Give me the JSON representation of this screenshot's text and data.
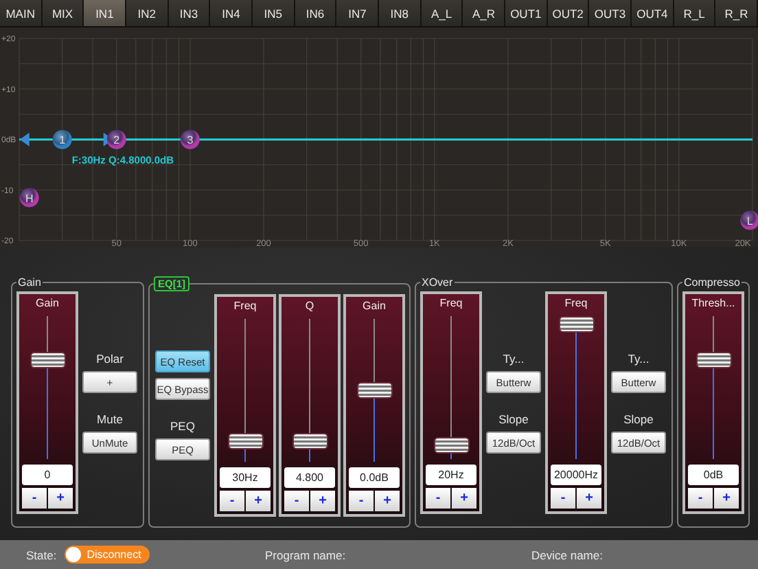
{
  "tabs": [
    {
      "label": "MAIN",
      "selected": false
    },
    {
      "label": "MIX",
      "selected": false
    },
    {
      "label": "IN1",
      "selected": true
    },
    {
      "label": "IN2",
      "selected": false
    },
    {
      "label": "IN3",
      "selected": false
    },
    {
      "label": "IN4",
      "selected": false
    },
    {
      "label": "IN5",
      "selected": false
    },
    {
      "label": "IN6",
      "selected": false
    },
    {
      "label": "IN7",
      "selected": false
    },
    {
      "label": "IN8",
      "selected": false
    },
    {
      "label": "A_L",
      "selected": false
    },
    {
      "label": "A_R",
      "selected": false
    },
    {
      "label": "OUT1",
      "selected": false
    },
    {
      "label": "OUT2",
      "selected": false
    },
    {
      "label": "OUT3",
      "selected": false
    },
    {
      "label": "OUT4",
      "selected": false
    },
    {
      "label": "R_L",
      "selected": false
    },
    {
      "label": "R_R",
      "selected": false
    }
  ],
  "graph": {
    "y_labels": [
      "+20",
      "+10",
      "0dB",
      "-10",
      "-20"
    ],
    "x_labels": [
      "50",
      "100",
      "200",
      "500",
      "1K",
      "2K",
      "5K",
      "10K",
      "20K"
    ],
    "nodes": [
      {
        "label": "1",
        "selected": true
      },
      {
        "label": "2",
        "selected": false
      },
      {
        "label": "3",
        "selected": false
      },
      {
        "label": "H",
        "selected": false
      },
      {
        "label": "L",
        "selected": false
      }
    ],
    "readout": "F:30Hz Q:4.8000.0dB"
  },
  "groups": [
    {
      "legend": "Gain",
      "kind": "plain",
      "items": [
        {
          "kind": "strip",
          "title": "Gain",
          "level": 0.72,
          "value": "0",
          "minus": "-",
          "plus": "+"
        },
        {
          "kind": "controls",
          "entries": [
            {
              "kind": "label",
              "text": "Polar"
            },
            {
              "kind": "button",
              "text": "+",
              "selected": false
            },
            {
              "kind": "label",
              "text": "Mute"
            },
            {
              "kind": "button",
              "text": "UnMute",
              "selected": false
            }
          ]
        }
      ]
    },
    {
      "legend": "EQ[1]",
      "kind": "tag",
      "items": [
        {
          "kind": "controls",
          "entries": [
            {
              "kind": "button",
              "text": "EQ Reset",
              "selected": true
            },
            {
              "kind": "button",
              "text": "EQ Bypass",
              "selected": false
            },
            {
              "kind": "label",
              "text": "PEQ"
            },
            {
              "kind": "button",
              "text": "PEQ",
              "selected": false
            }
          ]
        },
        {
          "kind": "strip",
          "title": "Freq",
          "level": 0.1,
          "value": "30Hz",
          "minus": "-",
          "plus": "+"
        },
        {
          "kind": "strip",
          "title": "Q",
          "level": 0.1,
          "value": "4.800",
          "minus": "-",
          "plus": "+"
        },
        {
          "kind": "strip",
          "title": "Gain",
          "level": 0.5,
          "value": "0.0dB",
          "minus": "-",
          "plus": "+"
        }
      ]
    },
    {
      "legend": "XOver",
      "kind": "plain",
      "items": [
        {
          "kind": "strip",
          "title": "Freq",
          "level": 0.04,
          "value": "20Hz",
          "minus": "-",
          "plus": "+"
        },
        {
          "kind": "controls",
          "entries": [
            {
              "kind": "label",
              "text": "Ty..."
            },
            {
              "kind": "button",
              "text": "Butterw",
              "selected": false
            },
            {
              "kind": "label",
              "text": "Slope"
            },
            {
              "kind": "button",
              "text": "12dB/Oct",
              "selected": false
            }
          ]
        },
        {
          "kind": "strip",
          "title": "Freq",
          "level": 1,
          "value": "20000Hz",
          "minus": "-",
          "plus": "+"
        },
        {
          "kind": "controls",
          "entries": [
            {
              "kind": "label",
              "text": "Ty..."
            },
            {
              "kind": "button",
              "text": "Butterw",
              "selected": false
            },
            {
              "kind": "label",
              "text": "Slope"
            },
            {
              "kind": "button",
              "text": "12dB/Oct",
              "selected": false
            }
          ]
        }
      ]
    },
    {
      "legend": "Compresso",
      "kind": "plain",
      "items": [
        {
          "kind": "strip",
          "title": "Thresh...",
          "level": 0.72,
          "value": "0dB",
          "minus": "-",
          "plus": "+"
        }
      ]
    }
  ],
  "status": {
    "state_label": "State:",
    "toggle": {
      "label": "Disconnect",
      "on": false
    },
    "program_label": "Program name:",
    "device_label": "Device name:"
  }
}
